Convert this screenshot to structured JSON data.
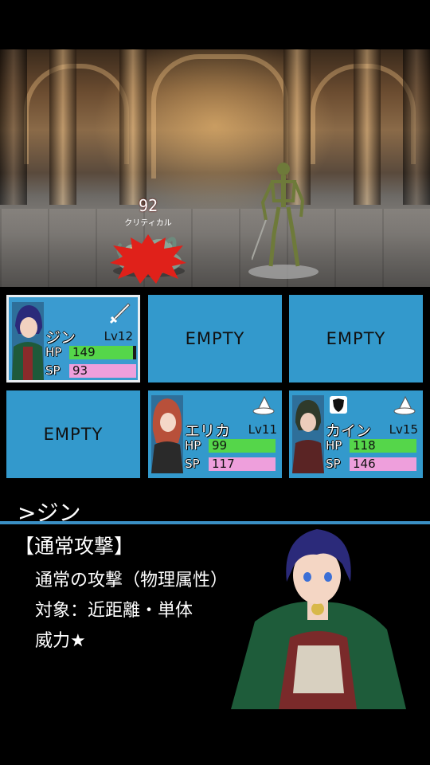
{
  "battle": {
    "damage_number": "92",
    "damage_label": "クリティカル"
  },
  "party": [
    {
      "slot": 1,
      "name": "ジン",
      "level": "Lv12",
      "hp_label": "HP",
      "hp": "149",
      "hp_fill": 0.95,
      "sp_label": "SP",
      "sp": "93",
      "sp_fill": 1.0,
      "class_icon": "sword-icon",
      "active": true
    },
    {
      "slot": 2,
      "empty_label": "EMPTY"
    },
    {
      "slot": 3,
      "empty_label": "EMPTY"
    },
    {
      "slot": 4,
      "empty_label": "EMPTY"
    },
    {
      "slot": 5,
      "name": "エリカ",
      "level": "Lv11",
      "hp_label": "HP",
      "hp": "99",
      "hp_fill": 1.0,
      "sp_label": "SP",
      "sp": "117",
      "sp_fill": 1.0,
      "class_icon": "witch-hat-icon"
    },
    {
      "slot": 6,
      "name": "カイン",
      "level": "Lv15",
      "hp_label": "HP",
      "hp": "118",
      "hp_fill": 1.0,
      "sp_label": "SP",
      "sp": "146",
      "sp_fill": 1.0,
      "class_icon": "witch-hat-icon",
      "extra_icon": "shield-icon"
    }
  ],
  "info": {
    "selected": ">ジン",
    "skill_title": "【通常攻撃】",
    "lines": [
      "通常の攻撃（物理属性）",
      "対象：近距離・単体",
      "威力★"
    ]
  },
  "colors": {
    "panel": "#3399cc",
    "hp": "#55d64a",
    "sp": "#ee9fdc",
    "divider": "#3a8fc4"
  }
}
